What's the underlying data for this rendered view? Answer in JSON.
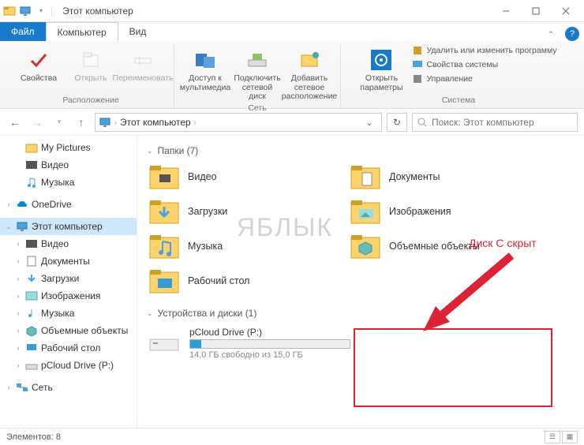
{
  "window": {
    "title": "Этот компьютер"
  },
  "tabs": {
    "file": "Файл",
    "computer": "Компьютер",
    "view": "Вид"
  },
  "ribbon": {
    "group_location": {
      "label": "Расположение",
      "properties": "Свойства",
      "open": "Открыть",
      "rename": "Переименовать"
    },
    "group_network": {
      "label": "Сеть",
      "media": "Доступ к мультимедиа",
      "map_drive": "Подключить сетевой диск",
      "add_network": "Добавить сетевое расположение"
    },
    "group_system": {
      "label": "Система",
      "open_params": "Открыть параметры",
      "uninstall": "Удалить или изменить программу",
      "sys_props": "Свойства системы",
      "manage": "Управление"
    }
  },
  "addressbar": {
    "crumb": "Этот компьютер"
  },
  "search": {
    "placeholder": "Поиск: Этот компьютер"
  },
  "nav": {
    "my_pictures": "My Pictures",
    "videos": "Видео",
    "music": "Музыка",
    "onedrive": "OneDrive",
    "this_pc": "Этот компьютер",
    "nvideos": "Видео",
    "ndocs": "Документы",
    "ndownloads": "Загрузки",
    "nimages": "Изображения",
    "nmusic": "Музыка",
    "n3d": "Объемные объекты",
    "ndesktop": "Рабочий стол",
    "npcloud": "pCloud Drive (P:)",
    "network": "Сеть"
  },
  "content": {
    "folders_header": "Папки (7)",
    "drives_header": "Устройства и диски (1)",
    "folders": {
      "videos": "Видео",
      "documents": "Документы",
      "downloads": "Загрузки",
      "images": "Изображения",
      "music": "Музыка",
      "objects3d": "Объемные объекты",
      "desktop": "Рабочий стол"
    },
    "drive": {
      "name": "pCloud Drive (P:)",
      "free": "14,0 ГБ свободно из 15,0 ГБ",
      "used_percent": 7,
      "fill_color": "#26a0da"
    }
  },
  "annotation": {
    "text": "Диск С скрыт"
  },
  "watermark": "ЯБЛЫК",
  "statusbar": {
    "items": "Элементов: 8"
  }
}
